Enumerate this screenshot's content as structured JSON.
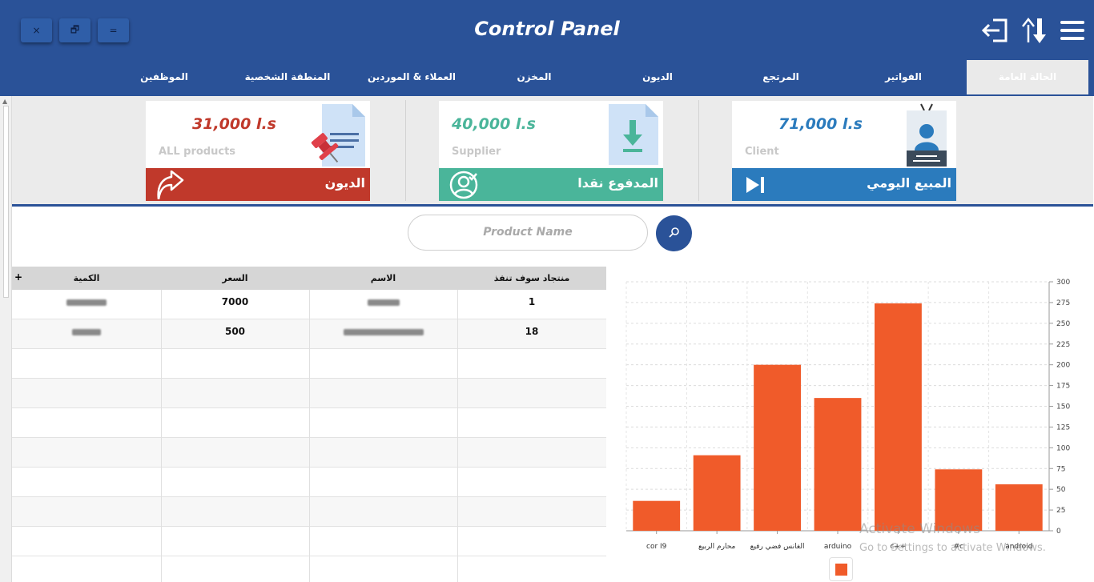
{
  "app": {
    "title": "Control Panel"
  },
  "window_buttons": [
    "×",
    "🗗",
    "="
  ],
  "tabs": [
    {
      "label": "الحالة العامة",
      "active": true
    },
    {
      "label": "الفواتير"
    },
    {
      "label": "المرتجع"
    },
    {
      "label": "الديون"
    },
    {
      "label": "المخزن"
    },
    {
      "label": "العملاء  &  الموردين"
    },
    {
      "label": "المنطقة الشخصية"
    },
    {
      "label": "الموظفين"
    }
  ],
  "cards": [
    {
      "amount": "31,000 l.s",
      "subtitle": "ALL products",
      "label": "الديون",
      "bar_color": "#c0392b",
      "amount_color": "#c0392b",
      "image": "document-pin-icon",
      "bar_icon": "arrow-up-icon"
    },
    {
      "amount": "40,000 l.s",
      "subtitle": "Supplier",
      "label": "المدفوع نقدا",
      "bar_color": "#4ab59a",
      "amount_color": "#4ab59a",
      "image": "download-document-icon",
      "bar_icon": "user-check-icon"
    },
    {
      "amount": "71,000 l.s",
      "subtitle": "Client",
      "label": "المبيع اليومي",
      "bar_color": "#2b7bbd",
      "amount_color": "#2b7bbd",
      "image": "id-badge-icon",
      "bar_icon": "skip-forward-icon"
    }
  ],
  "search": {
    "placeholder": "Product Name"
  },
  "table": {
    "headers": [
      "الكمية",
      "السعر",
      "الاسم",
      "منتجاد سوف تنفذ"
    ],
    "add": "+",
    "rows": [
      {
        "qty": "",
        "price": "7000",
        "name": "",
        "count": "1"
      },
      {
        "qty": "",
        "price": "500",
        "name": "",
        "count": "18"
      }
    ]
  },
  "chart_data": {
    "type": "bar",
    "categories": [
      "cor I9",
      "محارم الربيع",
      "الغانس فضي رفيع",
      "arduino",
      "c++",
      "#c",
      "android"
    ],
    "values": [
      36,
      91,
      200,
      160,
      274,
      74,
      56
    ],
    "ylim": [
      0,
      300
    ],
    "yticks": [
      0,
      25,
      50,
      75,
      100,
      125,
      150,
      175,
      200,
      225,
      250,
      275,
      300
    ],
    "color": "#f05b2a",
    "grid": true,
    "legend": "bottom"
  },
  "watermark": {
    "line1": "Activate Windows",
    "line2": "Go to Settings to activate Windows."
  }
}
